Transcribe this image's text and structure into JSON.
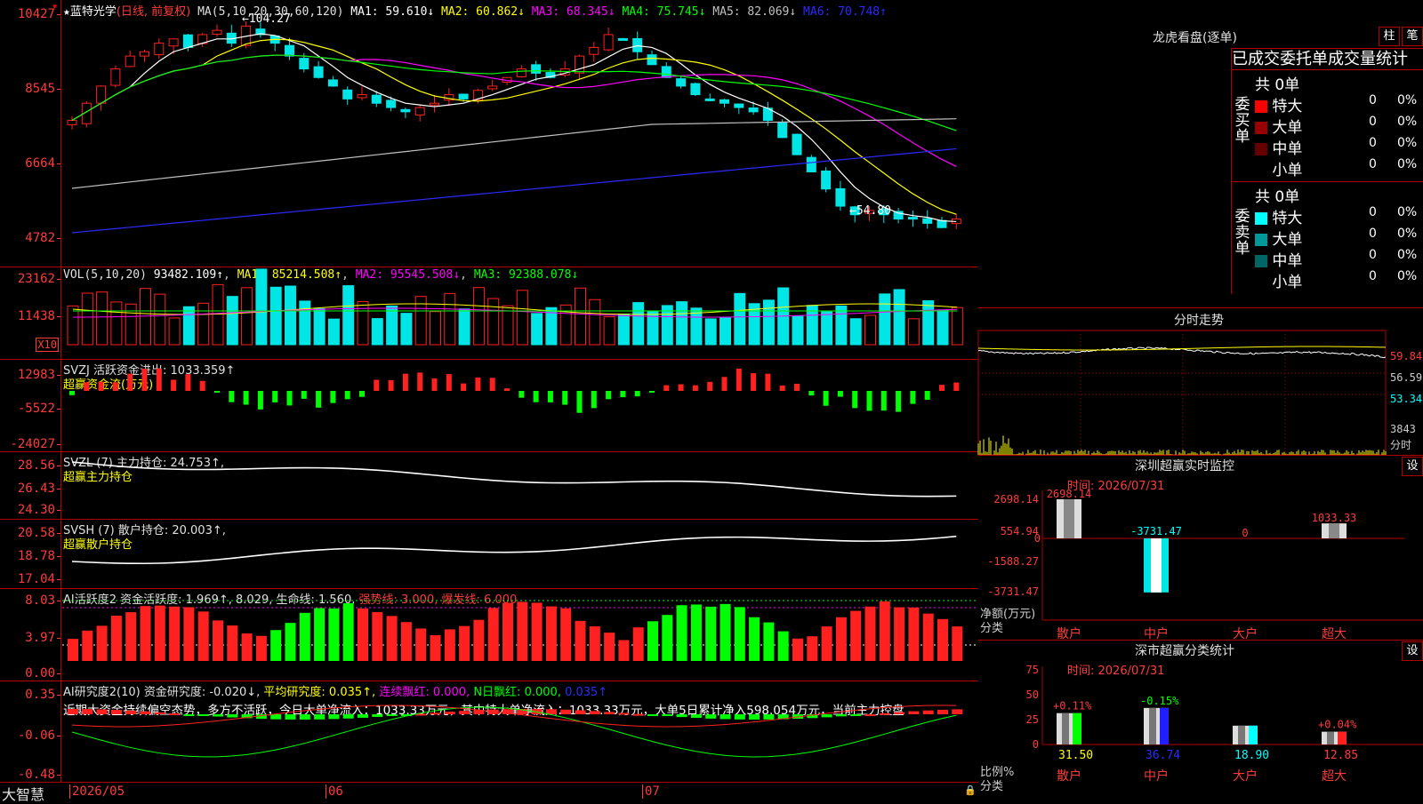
{
  "colors": {
    "up": "#ff2020",
    "down": "#00e5e5",
    "grid": "#b00000",
    "ma1": "#ffffff",
    "ma2": "#ffff00",
    "ma3": "#ff00ff",
    "ma4": "#00ff00",
    "ma5": "#c0c0c0",
    "ma6": "#2a2aff",
    "green": "#00ff00",
    "yellow": "#ffff00"
  },
  "main": {
    "star": "★",
    "name": "蓝特光学",
    "mode": "(日线, 前复权)",
    "ma_title": "MA(5,10,20,30,60,120)",
    "ma": [
      {
        "label": "MA1: 59.610↓",
        "color": "#ffffff"
      },
      {
        "label": "MA2: 60.862↓",
        "color": "#ffff00"
      },
      {
        "label": "MA3: 68.345↓",
        "color": "#ff00ff"
      },
      {
        "label": "MA4: 75.745↓",
        "color": "#00ff00"
      },
      {
        "label": "MA5: 82.069↓",
        "color": "#c0c0c0"
      },
      {
        "label": "MA6: 70.748↑",
        "color": "#2a2aff"
      }
    ],
    "y_labels": [
      "10427",
      "8545",
      "6664",
      "4782"
    ],
    "high_note": "←104.27",
    "low_note": "←54.80"
  },
  "vol": {
    "title": "VOL(5,10,20)",
    "value": "93482.109↑",
    "ma1": "MA1: 85214.508↑",
    "ma2": "MA2: 95545.508↓",
    "ma3": "MA3: 92388.078↓",
    "y_labels": [
      "23162",
      "11438"
    ],
    "unit": "X10"
  },
  "svzj": {
    "title": "SVZJ  活跃资金进出: 1033.359↑",
    "sub": "超赢资金流(万元)",
    "y_labels": [
      "12983",
      "-5522",
      "-24027"
    ]
  },
  "svzl": {
    "title": "SVZL (7) 主力持仓: 24.753↑,",
    "sub": "超赢主力持仓",
    "y_labels": [
      "28.56",
      "26.43",
      "24.30"
    ]
  },
  "svsh": {
    "title": "SVSH (7) 散户持仓: 20.003↑,",
    "sub": "超赢散户持仓",
    "y_labels": [
      "20.58",
      "18.78",
      "17.04"
    ]
  },
  "ai1": {
    "title": "AI活跃度2 资金活跃度: 1.969↑, 8.029, 生命线: 1.560,",
    "strong": "强势线: 3.000,",
    "burst": "爆发线: 6.000,",
    "y_labels": [
      "8.03",
      "3.97",
      "0.00"
    ]
  },
  "ai2": {
    "title": "AI研究度2(10) 资金研究度: -0.020↓, ",
    "avg": "平均研究度: 0.035↑,",
    "cont": "连续飘红: 0.000,",
    "nday": "N日飘红: 0.000,",
    "tail": "0.035↑",
    "text": "近期大资金持续偏空态势，多方不活跃，今日大单净流入：1033.33万元，其中特大单净流入：1033.33万元，大单5日累计净入598.054万元，当前主力控盘",
    "y_labels": [
      "0.35",
      "-0.06",
      "-0.48"
    ]
  },
  "bottom": {
    "brand": "大智慧",
    "dates": [
      "2026/05",
      "06",
      "07"
    ]
  },
  "right": {
    "dragon": {
      "title": "龙虎看盘(逐单)",
      "btn1": "柱",
      "btn2": "笔",
      "tabs": "已成交委托单成交量统计",
      "buy": {
        "label": "委买单",
        "count": "共 0单",
        "rows": [
          {
            "name": "特大",
            "v": "0",
            "p": "0%",
            "c": "#ff0000"
          },
          {
            "name": "大单",
            "v": "0",
            "p": "0%",
            "c": "#990000"
          },
          {
            "name": "中单",
            "v": "0",
            "p": "0%",
            "c": "#660000"
          },
          {
            "name": "小单",
            "v": "0",
            "p": "0%",
            "c": "#000000"
          }
        ]
      },
      "sell": {
        "label": "委卖单",
        "count": "共 0单",
        "rows": [
          {
            "name": "特大",
            "v": "0",
            "p": "0%",
            "c": "#00ffff"
          },
          {
            "name": "大单",
            "v": "0",
            "p": "0%",
            "c": "#009999"
          },
          {
            "name": "中单",
            "v": "0",
            "p": "0%",
            "c": "#006666"
          },
          {
            "name": "小单",
            "v": "0",
            "p": "0%",
            "c": "#000000"
          }
        ]
      }
    },
    "tick": {
      "title": "分时走势",
      "y_labels": [
        "59.84",
        "56.59",
        "53.34"
      ],
      "vol_label": "3843",
      "time_label": "分时"
    },
    "sz_monitor": {
      "title": "深圳超赢实时监控",
      "btn": "设",
      "time": "时间: 2026/07/31",
      "y_labels": [
        "2698.14",
        "554.94",
        "-1588.27",
        "-3731.47"
      ],
      "y_note": "净额(万元)",
      "x_note": "分类",
      "cats": [
        "散户",
        "中户",
        "大户",
        "超大"
      ],
      "bars": [
        {
          "label": "2698.14",
          "value": 2698.14
        },
        {
          "label": "-3731.47",
          "value": -3731.47
        },
        {
          "label": "0",
          "value": 0
        },
        {
          "label": "1033.33",
          "value": 1033.33
        }
      ],
      "zero": "0"
    },
    "sz_class": {
      "title": "深市超赢分类统计",
      "btn": "设",
      "time": "时间: 2026/07/31",
      "y_labels": [
        "75",
        "50",
        "25",
        "0"
      ],
      "y_note": "比例%",
      "x_note": "分类",
      "cats": [
        "散户",
        "中户",
        "大户",
        "超大"
      ],
      "bars": [
        {
          "value": 31.5,
          "label": "31.50",
          "delta": "+0.11%"
        },
        {
          "value": 36.74,
          "label": "36.74",
          "delta": "-0.15%"
        },
        {
          "value": 18.9,
          "label": "18.90",
          "delta": ""
        },
        {
          "value": 12.85,
          "label": "12.85",
          "delta": "+0.04%"
        }
      ]
    }
  }
}
